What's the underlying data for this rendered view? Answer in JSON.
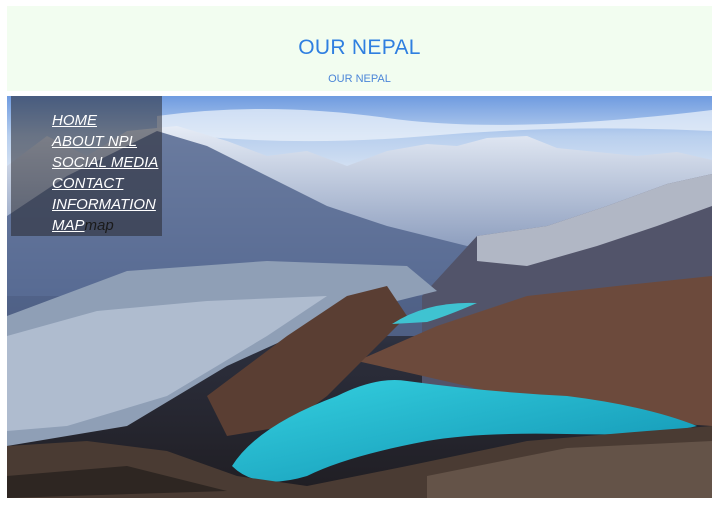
{
  "header": {
    "title": "OUR NEPAL",
    "subtitle": "OUR NEPAL"
  },
  "nav": {
    "items": [
      {
        "label": "HOME"
      },
      {
        "label": "ABOUT NPL"
      },
      {
        "label": "SOCIAL MEDIA"
      },
      {
        "label": "CONTACT"
      },
      {
        "label": "INFORMATION"
      },
      {
        "label": "MAP",
        "image_alt": "map"
      }
    ]
  },
  "colors": {
    "header_bg": "#f2fdf0",
    "title": "#2f7fe0",
    "lake": "#1fb2c8"
  }
}
